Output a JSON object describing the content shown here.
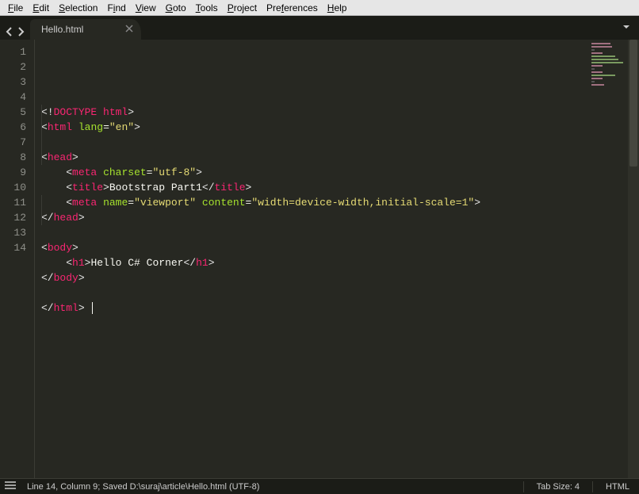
{
  "menu": {
    "items": [
      {
        "label": "File",
        "u": 0
      },
      {
        "label": "Edit",
        "u": 0
      },
      {
        "label": "Selection",
        "u": 0
      },
      {
        "label": "Find",
        "u": 1
      },
      {
        "label": "View",
        "u": 0
      },
      {
        "label": "Goto",
        "u": 0
      },
      {
        "label": "Tools",
        "u": 0
      },
      {
        "label": "Project",
        "u": 0
      },
      {
        "label": "Preferences",
        "u": 3
      },
      {
        "label": "Help",
        "u": 0
      }
    ]
  },
  "tabs": {
    "active": {
      "title": "Hello.html"
    }
  },
  "gutter": {
    "lines": 14
  },
  "code": {
    "lines": [
      [
        {
          "t": "<!",
          "c": "p-gray"
        },
        {
          "t": "DOCTYPE html",
          "c": "p-red"
        },
        {
          "t": ">",
          "c": "p-gray"
        }
      ],
      [
        {
          "t": "<",
          "c": "p-gray"
        },
        {
          "t": "html",
          "c": "p-red"
        },
        {
          "t": " ",
          "c": "p-wht"
        },
        {
          "t": "lang",
          "c": "p-green"
        },
        {
          "t": "=",
          "c": "p-wht"
        },
        {
          "t": "\"en\"",
          "c": "p-yell"
        },
        {
          "t": ">",
          "c": "p-gray"
        }
      ],
      [],
      [
        {
          "t": "<",
          "c": "p-gray"
        },
        {
          "t": "head",
          "c": "p-red"
        },
        {
          "t": ">",
          "c": "p-gray"
        }
      ],
      [
        {
          "t": "    ",
          "c": "p-wht"
        },
        {
          "t": "<",
          "c": "p-gray"
        },
        {
          "t": "meta",
          "c": "p-red"
        },
        {
          "t": " ",
          "c": "p-wht"
        },
        {
          "t": "charset",
          "c": "p-green"
        },
        {
          "t": "=",
          "c": "p-wht"
        },
        {
          "t": "\"utf-8\"",
          "c": "p-yell"
        },
        {
          "t": ">",
          "c": "p-gray"
        }
      ],
      [
        {
          "t": "    ",
          "c": "p-wht"
        },
        {
          "t": "<",
          "c": "p-gray"
        },
        {
          "t": "title",
          "c": "p-red"
        },
        {
          "t": ">",
          "c": "p-gray"
        },
        {
          "t": "Bootstrap Part1",
          "c": "p-wht"
        },
        {
          "t": "</",
          "c": "p-gray"
        },
        {
          "t": "title",
          "c": "p-red"
        },
        {
          "t": ">",
          "c": "p-gray"
        }
      ],
      [
        {
          "t": "    ",
          "c": "p-wht"
        },
        {
          "t": "<",
          "c": "p-gray"
        },
        {
          "t": "meta",
          "c": "p-red"
        },
        {
          "t": " ",
          "c": "p-wht"
        },
        {
          "t": "name",
          "c": "p-green"
        },
        {
          "t": "=",
          "c": "p-wht"
        },
        {
          "t": "\"viewport\"",
          "c": "p-yell"
        },
        {
          "t": " ",
          "c": "p-wht"
        },
        {
          "t": "content",
          "c": "p-green"
        },
        {
          "t": "=",
          "c": "p-wht"
        },
        {
          "t": "\"width=device-width,initial-scale=1\"",
          "c": "p-yell"
        },
        {
          "t": ">",
          "c": "p-gray"
        }
      ],
      [
        {
          "t": "</",
          "c": "p-gray"
        },
        {
          "t": "head",
          "c": "p-red"
        },
        {
          "t": ">",
          "c": "p-gray"
        }
      ],
      [],
      [
        {
          "t": "<",
          "c": "p-gray"
        },
        {
          "t": "body",
          "c": "p-red"
        },
        {
          "t": ">",
          "c": "p-gray"
        }
      ],
      [
        {
          "t": "    ",
          "c": "p-wht"
        },
        {
          "t": "<",
          "c": "p-gray"
        },
        {
          "t": "h1",
          "c": "p-red"
        },
        {
          "t": ">",
          "c": "p-gray"
        },
        {
          "t": "Hello C# Corner",
          "c": "p-wht"
        },
        {
          "t": "</",
          "c": "p-gray"
        },
        {
          "t": "h1",
          "c": "p-red"
        },
        {
          "t": ">",
          "c": "p-gray"
        }
      ],
      [
        {
          "t": "</",
          "c": "p-gray"
        },
        {
          "t": "body",
          "c": "p-red"
        },
        {
          "t": ">",
          "c": "p-gray"
        }
      ],
      [],
      [
        {
          "t": "</",
          "c": "p-gray"
        },
        {
          "t": "html",
          "c": "p-red"
        },
        {
          "t": ">",
          "c": "p-gray"
        },
        {
          "t": " ",
          "c": "p-wht",
          "cursor": true
        }
      ]
    ]
  },
  "statusbar": {
    "left": "Line 14, Column 9; Saved D:\\suraj\\article\\Hello.html (UTF-8)",
    "tabsize": "Tab Size: 4",
    "syntax": "HTML"
  }
}
